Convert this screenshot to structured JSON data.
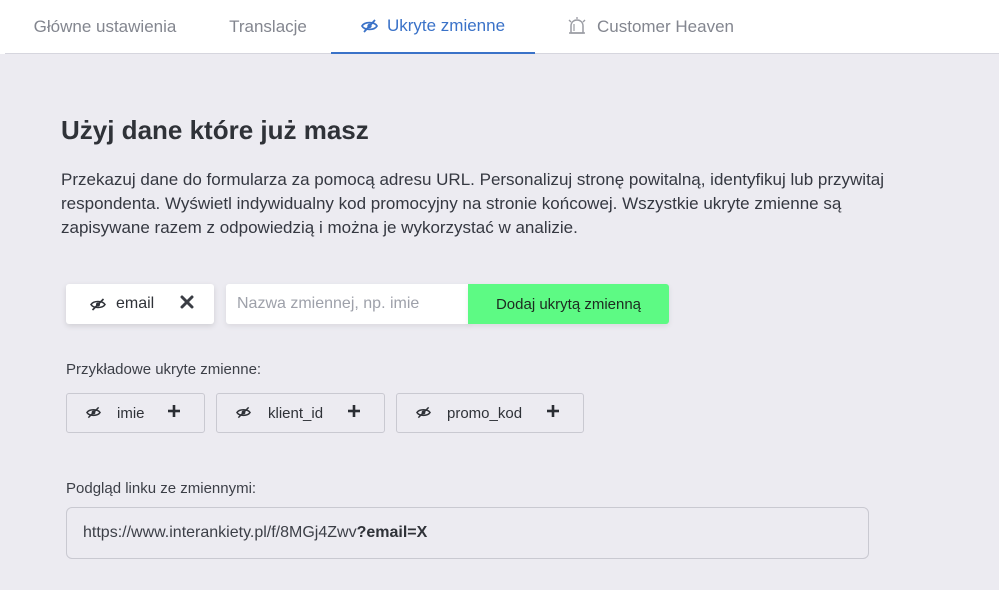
{
  "tabs": [
    {
      "label": "Główne ustawienia",
      "active": false
    },
    {
      "label": "Translacje",
      "active": false
    },
    {
      "label": "Ukryte zmienne",
      "active": true,
      "icon": "eye-slash-icon"
    },
    {
      "label": "Customer Heaven",
      "active": false,
      "icon": "bell-icon"
    }
  ],
  "main": {
    "title": "Użyj dane które już masz",
    "description": "Przekazuj dane do formularza za pomocą adresu URL. Personalizuj stronę powitalną, identyfikuj lub przywitaj respondenta. Wyświetl indywidualny kod promocyjny na stronie końcowej. Wszystkie ukryte zmienne są zapisywane razem z odpowiedzią i można je wykorzystać w analizie."
  },
  "variable_form": {
    "added_variable": "email",
    "name_input_value": "",
    "name_input_placeholder": "Nazwa zmiennej, np. imie",
    "add_button_label": "Dodaj ukrytą zmienną"
  },
  "examples": {
    "label": "Przykładowe ukryte zmienne:",
    "items": [
      "imie",
      "klient_id",
      "promo_kod"
    ]
  },
  "preview": {
    "label": "Podgląd linku ze zmiennymi:",
    "url_base": "https://www.interankiety.pl/f/8MGj4Zwv",
    "url_query": "?email=X"
  },
  "colors": {
    "accent": "#3a72c8",
    "add_button": "#5dfa84",
    "background": "#ecebf1"
  }
}
